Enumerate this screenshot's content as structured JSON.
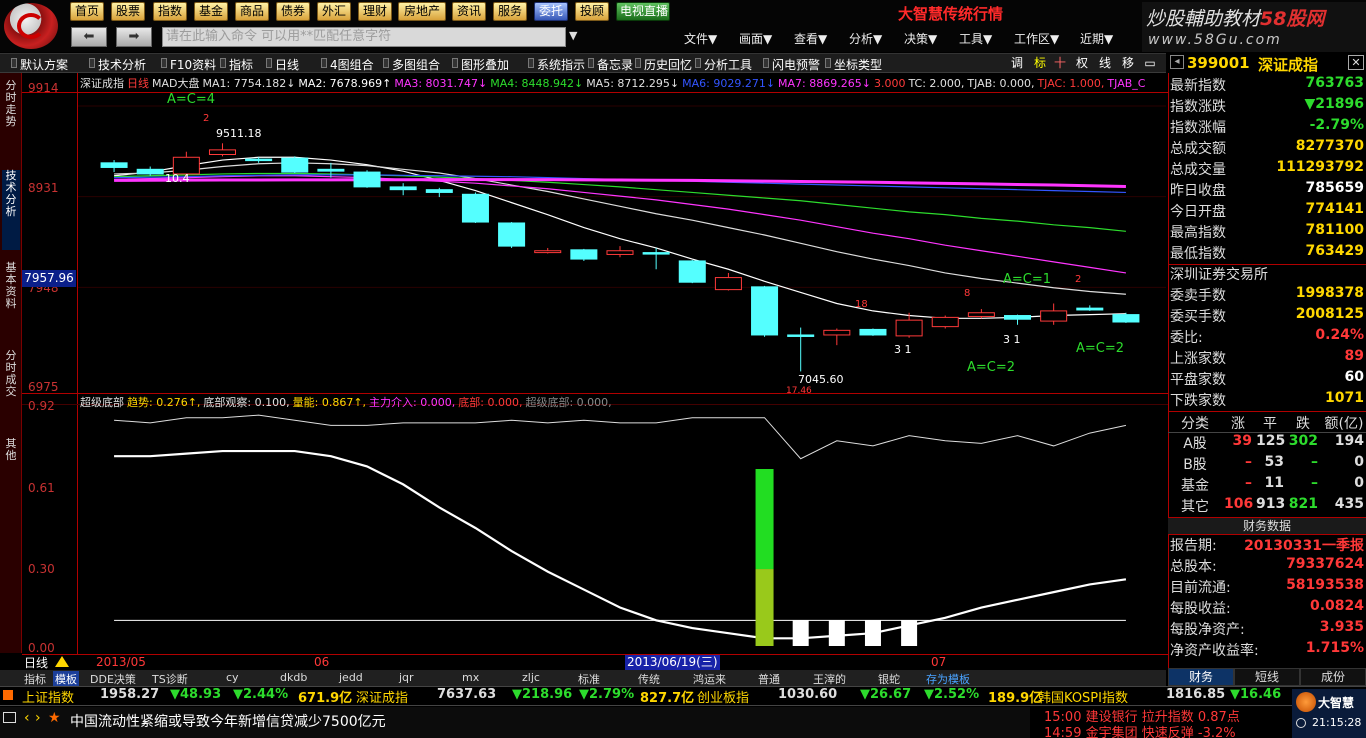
{
  "nav_buttons": [
    "首页",
    "股票",
    "指数",
    "基金",
    "商品",
    "债券",
    "外汇",
    "理财",
    "房地产",
    "资讯",
    "服务",
    "委托",
    "投顾",
    "电视直播"
  ],
  "brand_title": "大智慧传统行情",
  "promo": {
    "title_part1": "炒股輔助教材",
    "title_part2": "58股网",
    "url": "www.58Gu.com"
  },
  "command_placeholder": "请在此输入命令  可以用**匹配任意字符",
  "menus": [
    "文件▼",
    "画面▼",
    "查看▼",
    "分析▼",
    "决策▼",
    "工具▼",
    "工作区▼",
    "近期▼"
  ],
  "toolbar2": [
    "默认方案",
    "技术分析",
    "F10资料",
    "指标",
    "日线",
    "4图组合",
    "多图组合",
    "图形叠加",
    "系统指示",
    "备忘录",
    "历史回忆",
    "分析工具",
    "闪电预警",
    "坐标类型"
  ],
  "toolbar2_icons": [
    "调",
    "标",
    "十",
    "权",
    "线",
    "移"
  ],
  "side_tabs": [
    "分时走势",
    "技术分析",
    "基本资料",
    "分时成交",
    "其他"
  ],
  "stock_header": {
    "code": "399001",
    "name": "深证成指"
  },
  "ma_row": [
    {
      "t": "深证成指",
      "c": "#e0e0e0"
    },
    {
      "t": "日线",
      "c": "#ff3a3a"
    },
    {
      "t": "MAD大盘",
      "c": "#e0e0e0"
    },
    {
      "t": "MA1: 7754.182↓",
      "c": "#e0e0e0"
    },
    {
      "t": "MA2: 7678.969↑",
      "c": "#ffffff"
    },
    {
      "t": "MA3: 8031.747↓",
      "c": "#ff35ff"
    },
    {
      "t": "MA4: 8448.942↓",
      "c": "#2ddc2d"
    },
    {
      "t": "MA5: 8712.295↓",
      "c": "#e0e0e0"
    },
    {
      "t": "MA6: 9029.271↓",
      "c": "#3355ff"
    },
    {
      "t": "MA7: 8869.265↓",
      "c": "#ff35ff"
    },
    {
      "t": "3.000",
      "c": "#ff3a3a"
    },
    {
      "t": "TC: 2.000,",
      "c": "#e0e0e0"
    },
    {
      "t": "TJAB: 0.000,",
      "c": "#e0e0e0"
    },
    {
      "t": "TJAC: 1.000,",
      "c": "#ff3a3a"
    },
    {
      "t": "TJAB_C",
      "c": "#ff35ff"
    }
  ],
  "main_y_labels": [
    "9914",
    "8931",
    "7948",
    "6975"
  ],
  "current_price": "7957.96",
  "annotations": {
    "ac4": "A=C=4",
    "ac1": "A=C=1",
    "ac2a": "A=C=2",
    "ac2b": "A=C=2",
    "high": "9511.18",
    "low": "7045.60",
    "low_date": "17.46",
    "v1": "10.4",
    "r1": "2",
    "r2": "18",
    "r3": "8",
    "r4": "2",
    "n31a": "3 1",
    "n31b": "3 1"
  },
  "sub_row": [
    {
      "t": "超级底部",
      "c": "#e0e0e0"
    },
    {
      "t": "趋势: 0.276↑,",
      "c": "#ffd700"
    },
    {
      "t": "底部观察: 0.100,",
      "c": "#e0e0e0"
    },
    {
      "t": "量能: 0.867↑,",
      "c": "#ffd700"
    },
    {
      "t": "主力介入: 0.000,",
      "c": "#ff35ff"
    },
    {
      "t": "底部: 0.000,",
      "c": "#ff3a3a"
    },
    {
      "t": "超级底部: 0.000,",
      "c": "#888888"
    }
  ],
  "sub_y_labels": [
    "0.92",
    "0.61",
    "0.30",
    "0.00"
  ],
  "date_axis": {
    "left": "2013/05",
    "mid": "06",
    "sel": "2013/06/19(三)",
    "right": "07"
  },
  "period_label": "日线",
  "bottom_tabs": [
    "指标",
    "模板",
    "DDE决策",
    "TS诊断",
    "cy",
    "dkdb",
    "jedd",
    "jqr",
    "mx",
    "zljc",
    "标准",
    "传统",
    "鸿运来",
    "普通",
    "王滓的",
    "银蛇",
    "存为模板"
  ],
  "right_panel": [
    {
      "k": "最新指数",
      "v": "763763",
      "c": "grn"
    },
    {
      "k": "指数涨跌",
      "v": "▼21896",
      "c": "grn"
    },
    {
      "k": "指数涨幅",
      "v": "-2.79%",
      "c": "grn"
    },
    {
      "k": "总成交额",
      "v": "8277370",
      "c": "yel"
    },
    {
      "k": "总成交量",
      "v": "111293792",
      "c": "yel"
    },
    {
      "k": "昨日收盘",
      "v": "785659",
      "c": "wht"
    },
    {
      "k": "今日开盘",
      "v": "774141",
      "c": "yel"
    },
    {
      "k": "最高指数",
      "v": "781100",
      "c": "yel"
    },
    {
      "k": "最低指数",
      "v": "763429",
      "c": "yel"
    },
    {
      "k": "深圳证券交易所",
      "v": "",
      "c": "wht"
    },
    {
      "k": "委卖手数",
      "v": "1998378",
      "c": "yel"
    },
    {
      "k": "委买手数",
      "v": "2008125",
      "c": "yel"
    },
    {
      "k": "委比:",
      "v": "0.24%",
      "c": "red"
    },
    {
      "k": "上涨家数",
      "v": "89",
      "c": "red"
    },
    {
      "k": "平盘家数",
      "v": "60",
      "c": "wht"
    },
    {
      "k": "下跌家数",
      "v": "1071",
      "c": "yel"
    }
  ],
  "class_table": {
    "head": [
      "分类",
      "涨",
      "平",
      "跌",
      "额(亿)"
    ],
    "rows": [
      [
        "A股",
        "39",
        "125",
        "302",
        "194"
      ],
      [
        "B股",
        "–",
        "53",
        "–",
        "0"
      ],
      [
        "基金",
        "–",
        "11",
        "–",
        "0"
      ],
      [
        "其它",
        "106",
        "913",
        "821",
        "435"
      ]
    ]
  },
  "fin_title": "财务数据",
  "fin_rows": [
    {
      "k": "报告期:",
      "v": "20130331一季报"
    },
    {
      "k": "总股本:",
      "v": "79337624"
    },
    {
      "k": "目前流通:",
      "v": "58193538"
    },
    {
      "k": "每股收益:",
      "v": "0.0824"
    },
    {
      "k": "每股净资产:",
      "v": "3.935"
    },
    {
      "k": "净资产收益率:",
      "v": "1.715%"
    }
  ],
  "rp_tabs": [
    "财务",
    "短线",
    "成份"
  ],
  "ticker": [
    {
      "name": "上证指数",
      "val": "1958.27",
      "chg": "▼48.93",
      "pct": "▼2.44%",
      "amt": "671.9亿"
    },
    {
      "name": "深证成指",
      "val": "7637.63",
      "chg": "▼218.96",
      "pct": "▼2.79%",
      "amt": "827.7亿"
    },
    {
      "name": "创业板指",
      "val": "1030.60",
      "chg": "▼26.67",
      "pct": "▼2.52%",
      "amt": "189.9亿"
    },
    {
      "name": "韩国KOSPI指数",
      "val": "1816.85",
      "chg": "▼16.46",
      "pct": "",
      "amt": ""
    }
  ],
  "news_text": "中国流动性紧缩或导致今年新增信贷减少7500亿元",
  "news_right": [
    {
      "time": "15:00",
      "text": "建设银行 拉升指数 0.87点"
    },
    {
      "time": "14:59",
      "text": "金宇集团 快速反弹 -3.2%"
    }
  ],
  "clock_brand": "大智慧",
  "clock_time": "21:15:28",
  "chart_data": {
    "type": "candlestick",
    "title": "深证成指 日线",
    "ylim": [
      6975,
      9914
    ],
    "candles": [
      {
        "o": 9300,
        "c": 9250,
        "h": 9330,
        "l": 9200
      },
      {
        "o": 9230,
        "c": 9180,
        "h": 9260,
        "l": 9160
      },
      {
        "o": 9180,
        "c": 9360,
        "h": 9420,
        "l": 9150
      },
      {
        "o": 9390,
        "c": 9440,
        "h": 9511,
        "l": 9370
      },
      {
        "o": 9340,
        "c": 9330,
        "h": 9360,
        "l": 9300
      },
      {
        "o": 9350,
        "c": 9200,
        "h": 9370,
        "l": 9190
      },
      {
        "o": 9230,
        "c": 9210,
        "h": 9300,
        "l": 9140
      },
      {
        "o": 9200,
        "c": 9040,
        "h": 9220,
        "l": 9030
      },
      {
        "o": 9040,
        "c": 9010,
        "h": 9080,
        "l": 8950
      },
      {
        "o": 9010,
        "c": 8980,
        "h": 9030,
        "l": 8930
      },
      {
        "o": 8960,
        "c": 8660,
        "h": 8980,
        "l": 8650
      },
      {
        "o": 8650,
        "c": 8400,
        "h": 8660,
        "l": 8380
      },
      {
        "o": 8330,
        "c": 8350,
        "h": 8380,
        "l": 8320
      },
      {
        "o": 8360,
        "c": 8260,
        "h": 8370,
        "l": 8240
      },
      {
        "o": 8310,
        "c": 8350,
        "h": 8400,
        "l": 8280
      },
      {
        "o": 8330,
        "c": 8320,
        "h": 8380,
        "l": 8150
      },
      {
        "o": 8240,
        "c": 8010,
        "h": 8250,
        "l": 8000
      },
      {
        "o": 7930,
        "c": 8060,
        "h": 8110,
        "l": 7920
      },
      {
        "o": 7960,
        "c": 7440,
        "h": 7970,
        "l": 7420
      },
      {
        "o": 7440,
        "c": 7430,
        "h": 7520,
        "l": 7046
      },
      {
        "o": 7440,
        "c": 7490,
        "h": 7510,
        "l": 7330
      },
      {
        "o": 7500,
        "c": 7440,
        "h": 7510,
        "l": 7430
      },
      {
        "o": 7430,
        "c": 7600,
        "h": 7680,
        "l": 7410
      },
      {
        "o": 7530,
        "c": 7630,
        "h": 7650,
        "l": 7510
      },
      {
        "o": 7640,
        "c": 7680,
        "h": 7720,
        "l": 7620
      },
      {
        "o": 7650,
        "c": 7610,
        "h": 7660,
        "l": 7550
      },
      {
        "o": 7590,
        "c": 7700,
        "h": 7780,
        "l": 7550
      },
      {
        "o": 7730,
        "c": 7710,
        "h": 7760,
        "l": 7700
      },
      {
        "o": 7660,
        "c": 7580,
        "h": 7680,
        "l": 7570
      }
    ],
    "ma_lines": [
      {
        "color": "#ffffff",
        "values": [
          9160,
          9200,
          9270,
          9330,
          9360,
          9360,
          9330,
          9280,
          9210,
          9110,
          9000,
          8870,
          8740,
          8600,
          8480,
          8380,
          8260,
          8150,
          8020,
          7900,
          7780,
          7700,
          7650,
          7620,
          7620,
          7630,
          7650,
          7660,
          7670
        ]
      },
      {
        "color": "#dcdcdc",
        "values": [
          9180,
          9190,
          9220,
          9260,
          9290,
          9300,
          9290,
          9270,
          9230,
          9190,
          9130,
          9060,
          8990,
          8910,
          8830,
          8750,
          8680,
          8600,
          8520,
          8430,
          8340,
          8260,
          8190,
          8110,
          8050,
          8000,
          7950,
          7910,
          7880
        ]
      },
      {
        "color": "#ff35ff",
        "values": [
          9120,
          9130,
          9140,
          9150,
          9160,
          9160,
          9150,
          9140,
          9120,
          9100,
          9080,
          9050,
          9020,
          8980,
          8940,
          8900,
          8850,
          8800,
          8740,
          8680,
          8610,
          8540,
          8480,
          8410,
          8350,
          8290,
          8230,
          8170,
          8110
        ]
      },
      {
        "color": "#2ddc2d",
        "values": [
          9150,
          9160,
          9170,
          9180,
          9185,
          9185,
          9180,
          9170,
          9160,
          9145,
          9130,
          9110,
          9090,
          9065,
          9040,
          9010,
          8980,
          8950,
          8920,
          8890,
          8850,
          8810,
          8770,
          8740,
          8700,
          8670,
          8630,
          8600,
          8560
        ]
      },
      {
        "color": "#3355ff",
        "values": [
          9140,
          9145,
          9150,
          9160,
          9165,
          9170,
          9170,
          9170,
          9165,
          9160,
          9155,
          9150,
          9140,
          9130,
          9120,
          9110,
          9100,
          9090,
          9080,
          9070,
          9060,
          9050,
          9040,
          9030,
          9020,
          9010,
          9000,
          8990,
          8980
        ]
      },
      {
        "color": "#ff35ff",
        "values": [
          9110,
          9112,
          9113,
          9114,
          9115,
          9116,
          9116,
          9117,
          9117,
          9118,
          9118,
          9118,
          9118,
          9116,
          9114,
          9112,
          9110,
          9106,
          9102,
          9098,
          9094,
          9090,
          9084,
          9078,
          9072,
          9066,
          9060,
          9052,
          9044
        ]
      }
    ],
    "sub_ylim": [
      0,
      0.92
    ],
    "sub_lines": [
      {
        "name": "趋势",
        "color": "#ffffff",
        "values": [
          0.74,
          0.74,
          0.75,
          0.76,
          0.76,
          0.76,
          0.74,
          0.7,
          0.63,
          0.54,
          0.46,
          0.37,
          0.29,
          0.22,
          0.15,
          0.1,
          0.07,
          0.05,
          0.03,
          0.03,
          0.04,
          0.05,
          0.08,
          0.11,
          0.15,
          0.18,
          0.21,
          0.24,
          0.26
        ]
      },
      {
        "name": "量能",
        "color": "#dddddd",
        "values": [
          0.88,
          0.87,
          0.89,
          0.89,
          0.9,
          0.88,
          0.86,
          0.86,
          0.87,
          0.87,
          0.87,
          0.88,
          0.87,
          0.88,
          0.87,
          0.87,
          0.89,
          0.89,
          0.89,
          0.73,
          0.8,
          0.78,
          0.82,
          0.8,
          0.79,
          0.82,
          0.78,
          0.83,
          0.86
        ]
      },
      {
        "name": "底部观察",
        "color": "#ffffff",
        "values": [
          0.1,
          0.1,
          0.1,
          0.1,
          0.1,
          0.1,
          0.1,
          0.1,
          0.1,
          0.1,
          0.1,
          0.1,
          0.1,
          0.1,
          0.1,
          0.1,
          0.1,
          0.1,
          0.1,
          0.1,
          0.1,
          0.1,
          0.1,
          0.1,
          0.1,
          0.1,
          0.1,
          0.1,
          0.1
        ]
      }
    ],
    "sub_bars": [
      {
        "i": 18,
        "value": 0.69
      },
      {
        "i": 19,
        "value": 0.1
      },
      {
        "i": 20,
        "value": 0.1
      },
      {
        "i": 21,
        "value": 0.1
      },
      {
        "i": 22,
        "value": 0.1
      }
    ]
  }
}
